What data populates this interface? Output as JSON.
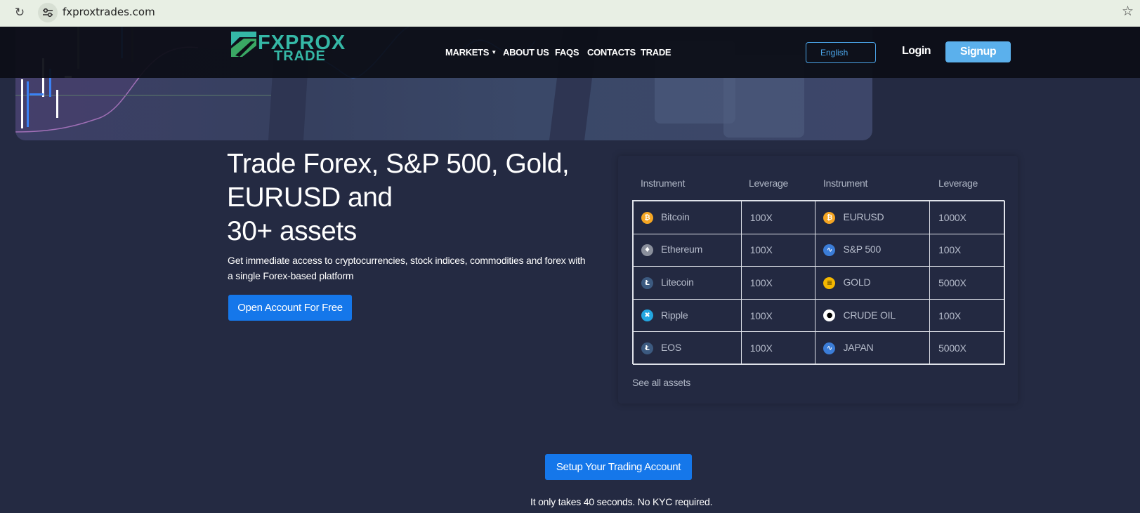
{
  "browser": {
    "url": "fxproxtrades.com",
    "reload_icon": "reload-icon",
    "site_info_icon": "tune-icon",
    "bookmark_icon": "star-outline-icon"
  },
  "header": {
    "logo_line1": "FXPROX",
    "logo_line2": "TRADE",
    "nav": [
      {
        "label": "MARKETS",
        "has_dropdown": true
      },
      {
        "label": "ABOUT US"
      },
      {
        "label": "FAQS"
      },
      {
        "label": "CONTACTS"
      },
      {
        "label": "TRADE"
      }
    ],
    "language": "English",
    "login_label": "Login",
    "signup_label": "Signup"
  },
  "hero": {
    "title_line1": "Trade Forex, S&P 500, Gold,",
    "title_line2": "EURUSD and",
    "title_line3": "30+ assets",
    "subtitle": "Get immediate access to cryptocurrencies, stock indices, commodities and forex with a single Forex-based platform",
    "cta_label": "Open Account For Free"
  },
  "instruments": {
    "headers": [
      "Instrument",
      "Leverage",
      "Instrument",
      "Leverage"
    ],
    "rows": [
      {
        "name1": "Bitcoin",
        "icon1": "bitcoin-icon",
        "lev1": "100X",
        "name2": "EURUSD",
        "icon2": "bitcoin-icon",
        "lev2": "1000X"
      },
      {
        "name1": "Ethereum",
        "icon1": "ethereum-icon",
        "lev1": "100X",
        "name2": "S&P 500",
        "icon2": "trend-icon",
        "lev2": "100X"
      },
      {
        "name1": "Litecoin",
        "icon1": "litecoin-icon",
        "lev1": "100X",
        "name2": "GOLD",
        "icon2": "gold-icon",
        "lev2": "5000X"
      },
      {
        "name1": "Ripple",
        "icon1": "ripple-icon",
        "lev1": "100X",
        "name2": "CRUDE OIL",
        "icon2": "oil-drop-icon",
        "lev2": "100X"
      },
      {
        "name1": "EOS",
        "icon1": "eos-icon",
        "lev1": "100X",
        "name2": "JAPAN",
        "icon2": "trend-icon",
        "lev2": "5000X"
      }
    ],
    "see_all_label": "See all assets"
  },
  "setup": {
    "cta_label": "Setup Your Trading Account",
    "note": "It only takes 40 seconds. No KYC required."
  },
  "colors": {
    "page_bg": "#242a42",
    "accent_blue": "#1577ea",
    "signup_blue": "#5bb0ec",
    "logo_teal": "#35b8a6"
  }
}
